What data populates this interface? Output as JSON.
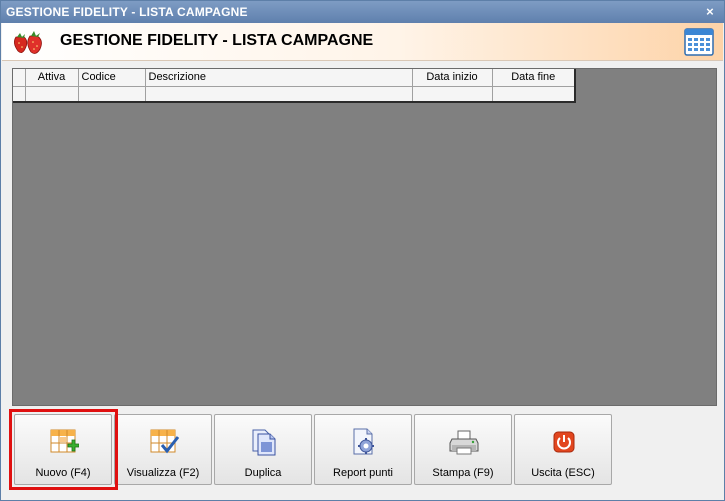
{
  "window": {
    "title": "GESTIONE FIDELITY - LISTA CAMPAGNE",
    "close_symbol": "×"
  },
  "header": {
    "title": "GESTIONE FIDELITY - LISTA CAMPAGNE",
    "logo_icon": "strawberry-icon",
    "right_icon": "calendar-icon"
  },
  "grid": {
    "columns": [
      "",
      "Attiva",
      "Codice",
      "Descrizione",
      "Data inizio",
      "Data fine"
    ],
    "rows": [
      [
        "",
        "",
        "",
        "",
        "",
        ""
      ]
    ]
  },
  "toolbar": {
    "buttons": [
      {
        "label": "Nuovo (F4)",
        "icon": "grid-add-icon"
      },
      {
        "label": "Visualizza (F2)",
        "icon": "grid-check-icon"
      },
      {
        "label": "Duplica",
        "icon": "duplicate-pages-icon"
      },
      {
        "label": "Report punti",
        "icon": "report-gear-icon"
      },
      {
        "label": "Stampa (F9)",
        "icon": "printer-icon"
      },
      {
        "label": "Uscita (ESC)",
        "icon": "power-icon"
      }
    ]
  },
  "colors": {
    "titlebar": "#6f8fba",
    "grid_background": "#808080",
    "header_gradient_end": "#fdd3a8",
    "focus_ring": "#e01010"
  }
}
